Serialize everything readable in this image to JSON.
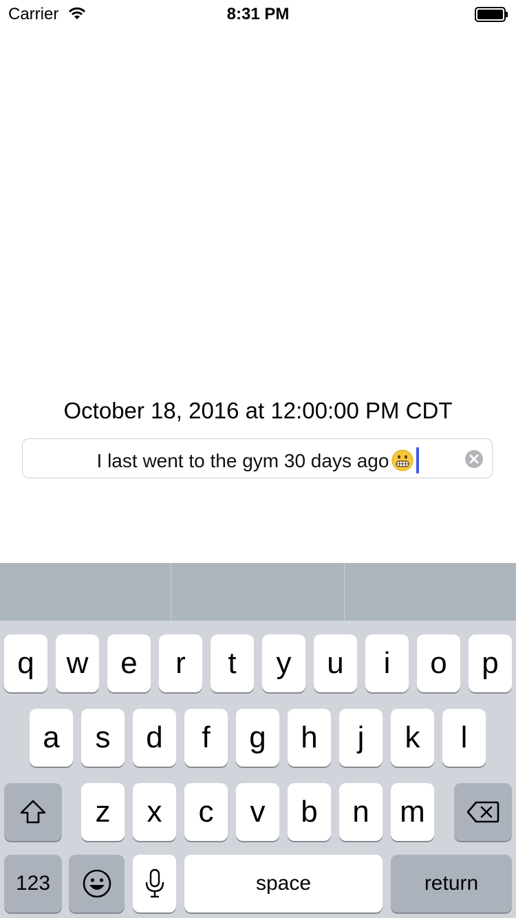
{
  "status_bar": {
    "carrier": "Carrier",
    "time": "8:31 PM"
  },
  "content": {
    "date_label": "October 18, 2016 at 12:00:00 PM CDT",
    "text_field": {
      "value": "I last went to the gym 30 days ago",
      "emoji": "grimacing-face"
    }
  },
  "keyboard": {
    "row1": [
      "q",
      "w",
      "e",
      "r",
      "t",
      "y",
      "u",
      "i",
      "o",
      "p"
    ],
    "row2": [
      "a",
      "s",
      "d",
      "f",
      "g",
      "h",
      "j",
      "k",
      "l"
    ],
    "row3": [
      "z",
      "x",
      "c",
      "v",
      "b",
      "n",
      "m"
    ],
    "numbers_key": "123",
    "space_key": "space",
    "return_key": "return",
    "icons": {
      "shift": "shift-icon",
      "delete": "backspace-icon",
      "emoji": "emoji-icon",
      "dictation": "microphone-icon"
    }
  },
  "colors": {
    "cursor": "#3f59e4",
    "keyboard_bg": "#d1d5db",
    "special_key": "#abb2bc",
    "suggestion_bar": "#adb5bd"
  }
}
